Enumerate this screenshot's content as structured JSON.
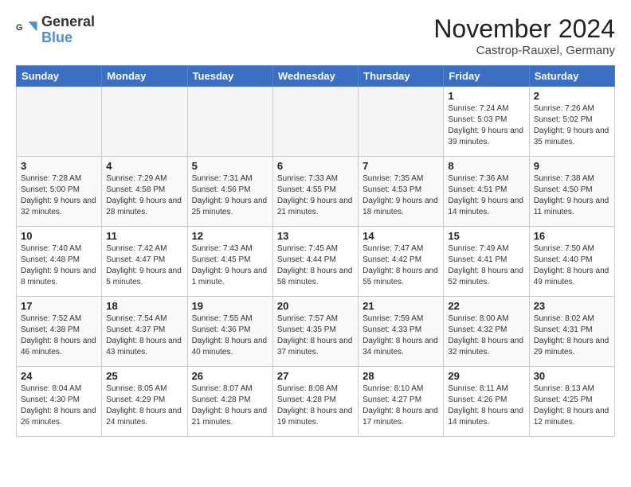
{
  "header": {
    "logo_general": "General",
    "logo_blue": "Blue",
    "title": "November 2024",
    "location": "Castrop-Rauxel, Germany"
  },
  "days_of_week": [
    "Sunday",
    "Monday",
    "Tuesday",
    "Wednesday",
    "Thursday",
    "Friday",
    "Saturday"
  ],
  "weeks": [
    [
      {
        "day": "",
        "info": ""
      },
      {
        "day": "",
        "info": ""
      },
      {
        "day": "",
        "info": ""
      },
      {
        "day": "",
        "info": ""
      },
      {
        "day": "",
        "info": ""
      },
      {
        "day": "1",
        "info": "Sunrise: 7:24 AM\nSunset: 5:03 PM\nDaylight: 9 hours and 39 minutes."
      },
      {
        "day": "2",
        "info": "Sunrise: 7:26 AM\nSunset: 5:02 PM\nDaylight: 9 hours and 35 minutes."
      }
    ],
    [
      {
        "day": "3",
        "info": "Sunrise: 7:28 AM\nSunset: 5:00 PM\nDaylight: 9 hours and 32 minutes."
      },
      {
        "day": "4",
        "info": "Sunrise: 7:29 AM\nSunset: 4:58 PM\nDaylight: 9 hours and 28 minutes."
      },
      {
        "day": "5",
        "info": "Sunrise: 7:31 AM\nSunset: 4:56 PM\nDaylight: 9 hours and 25 minutes."
      },
      {
        "day": "6",
        "info": "Sunrise: 7:33 AM\nSunset: 4:55 PM\nDaylight: 9 hours and 21 minutes."
      },
      {
        "day": "7",
        "info": "Sunrise: 7:35 AM\nSunset: 4:53 PM\nDaylight: 9 hours and 18 minutes."
      },
      {
        "day": "8",
        "info": "Sunrise: 7:36 AM\nSunset: 4:51 PM\nDaylight: 9 hours and 14 minutes."
      },
      {
        "day": "9",
        "info": "Sunrise: 7:38 AM\nSunset: 4:50 PM\nDaylight: 9 hours and 11 minutes."
      }
    ],
    [
      {
        "day": "10",
        "info": "Sunrise: 7:40 AM\nSunset: 4:48 PM\nDaylight: 9 hours and 8 minutes."
      },
      {
        "day": "11",
        "info": "Sunrise: 7:42 AM\nSunset: 4:47 PM\nDaylight: 9 hours and 5 minutes."
      },
      {
        "day": "12",
        "info": "Sunrise: 7:43 AM\nSunset: 4:45 PM\nDaylight: 9 hours and 1 minute."
      },
      {
        "day": "13",
        "info": "Sunrise: 7:45 AM\nSunset: 4:44 PM\nDaylight: 8 hours and 58 minutes."
      },
      {
        "day": "14",
        "info": "Sunrise: 7:47 AM\nSunset: 4:42 PM\nDaylight: 8 hours and 55 minutes."
      },
      {
        "day": "15",
        "info": "Sunrise: 7:49 AM\nSunset: 4:41 PM\nDaylight: 8 hours and 52 minutes."
      },
      {
        "day": "16",
        "info": "Sunrise: 7:50 AM\nSunset: 4:40 PM\nDaylight: 8 hours and 49 minutes."
      }
    ],
    [
      {
        "day": "17",
        "info": "Sunrise: 7:52 AM\nSunset: 4:38 PM\nDaylight: 8 hours and 46 minutes."
      },
      {
        "day": "18",
        "info": "Sunrise: 7:54 AM\nSunset: 4:37 PM\nDaylight: 8 hours and 43 minutes."
      },
      {
        "day": "19",
        "info": "Sunrise: 7:55 AM\nSunset: 4:36 PM\nDaylight: 8 hours and 40 minutes."
      },
      {
        "day": "20",
        "info": "Sunrise: 7:57 AM\nSunset: 4:35 PM\nDaylight: 8 hours and 37 minutes."
      },
      {
        "day": "21",
        "info": "Sunrise: 7:59 AM\nSunset: 4:33 PM\nDaylight: 8 hours and 34 minutes."
      },
      {
        "day": "22",
        "info": "Sunrise: 8:00 AM\nSunset: 4:32 PM\nDaylight: 8 hours and 32 minutes."
      },
      {
        "day": "23",
        "info": "Sunrise: 8:02 AM\nSunset: 4:31 PM\nDaylight: 8 hours and 29 minutes."
      }
    ],
    [
      {
        "day": "24",
        "info": "Sunrise: 8:04 AM\nSunset: 4:30 PM\nDaylight: 8 hours and 26 minutes."
      },
      {
        "day": "25",
        "info": "Sunrise: 8:05 AM\nSunset: 4:29 PM\nDaylight: 8 hours and 24 minutes."
      },
      {
        "day": "26",
        "info": "Sunrise: 8:07 AM\nSunset: 4:28 PM\nDaylight: 8 hours and 21 minutes."
      },
      {
        "day": "27",
        "info": "Sunrise: 8:08 AM\nSunset: 4:28 PM\nDaylight: 8 hours and 19 minutes."
      },
      {
        "day": "28",
        "info": "Sunrise: 8:10 AM\nSunset: 4:27 PM\nDaylight: 8 hours and 17 minutes."
      },
      {
        "day": "29",
        "info": "Sunrise: 8:11 AM\nSunset: 4:26 PM\nDaylight: 8 hours and 14 minutes."
      },
      {
        "day": "30",
        "info": "Sunrise: 8:13 AM\nSunset: 4:25 PM\nDaylight: 8 hours and 12 minutes."
      }
    ]
  ]
}
